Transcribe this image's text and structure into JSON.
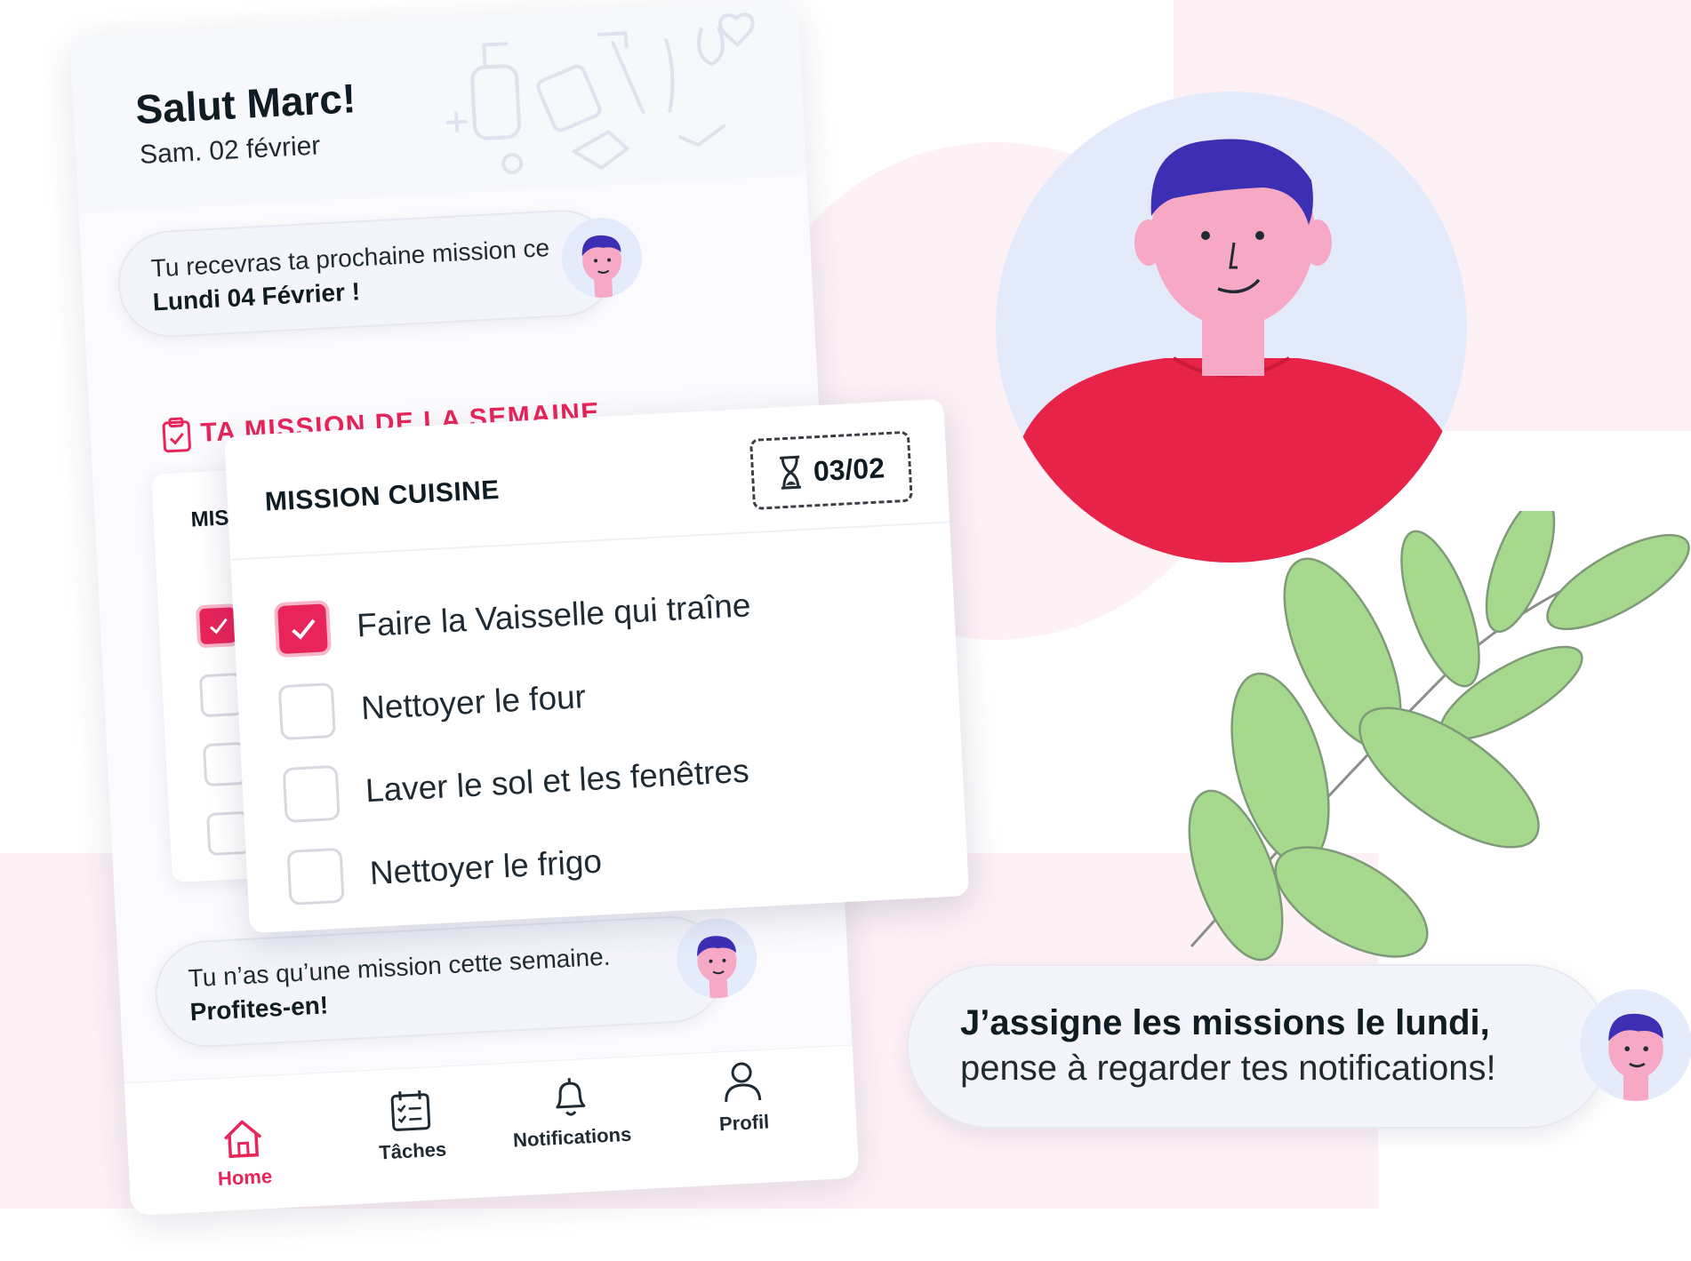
{
  "header": {
    "greeting": "Salut Marc!",
    "date": "Sam. 02 février"
  },
  "next_mission_bubble": {
    "line1": "Tu recevras ta prochaine mission ce",
    "line2": "Lundi 04 Février !"
  },
  "section": {
    "title": "TA MISSION DE LA SEMAINE"
  },
  "back_card": {
    "title": "MISSION CUISINE",
    "checks": [
      true,
      false,
      false,
      false
    ]
  },
  "mission_card": {
    "title": "MISSION CUISINE",
    "deadline": "03/02",
    "tasks": [
      {
        "label": "Faire la Vaisselle qui traîne",
        "done": true
      },
      {
        "label": "Nettoyer le four",
        "done": false
      },
      {
        "label": "Laver le sol et les fenêtres",
        "done": false
      },
      {
        "label": "Nettoyer le frigo",
        "done": false
      }
    ]
  },
  "single_mission_bubble": {
    "line1": "Tu n’as qu’une mission cette semaine.",
    "line2": "Profites-en!"
  },
  "navbar": {
    "items": [
      {
        "label": "Home",
        "icon": "home-icon",
        "active": true
      },
      {
        "label": "Tâches",
        "icon": "calendar-check-icon",
        "active": false
      },
      {
        "label": "Notifications",
        "icon": "bell-icon",
        "active": false
      },
      {
        "label": "Profil",
        "icon": "user-icon",
        "active": false
      }
    ]
  },
  "speech_bubble": {
    "line1": "J’assigne les missions le lundi,",
    "line2": "pense à regarder tes notifications!"
  },
  "colors": {
    "accent": "#e8245a",
    "shirt": "#e8234a",
    "skin": "#f6a8c4",
    "hair": "#3d2fb4",
    "leaf": "#a6d98e",
    "background_tint": "#fdf1f6",
    "avatar_bg": "#e3ebfb"
  }
}
